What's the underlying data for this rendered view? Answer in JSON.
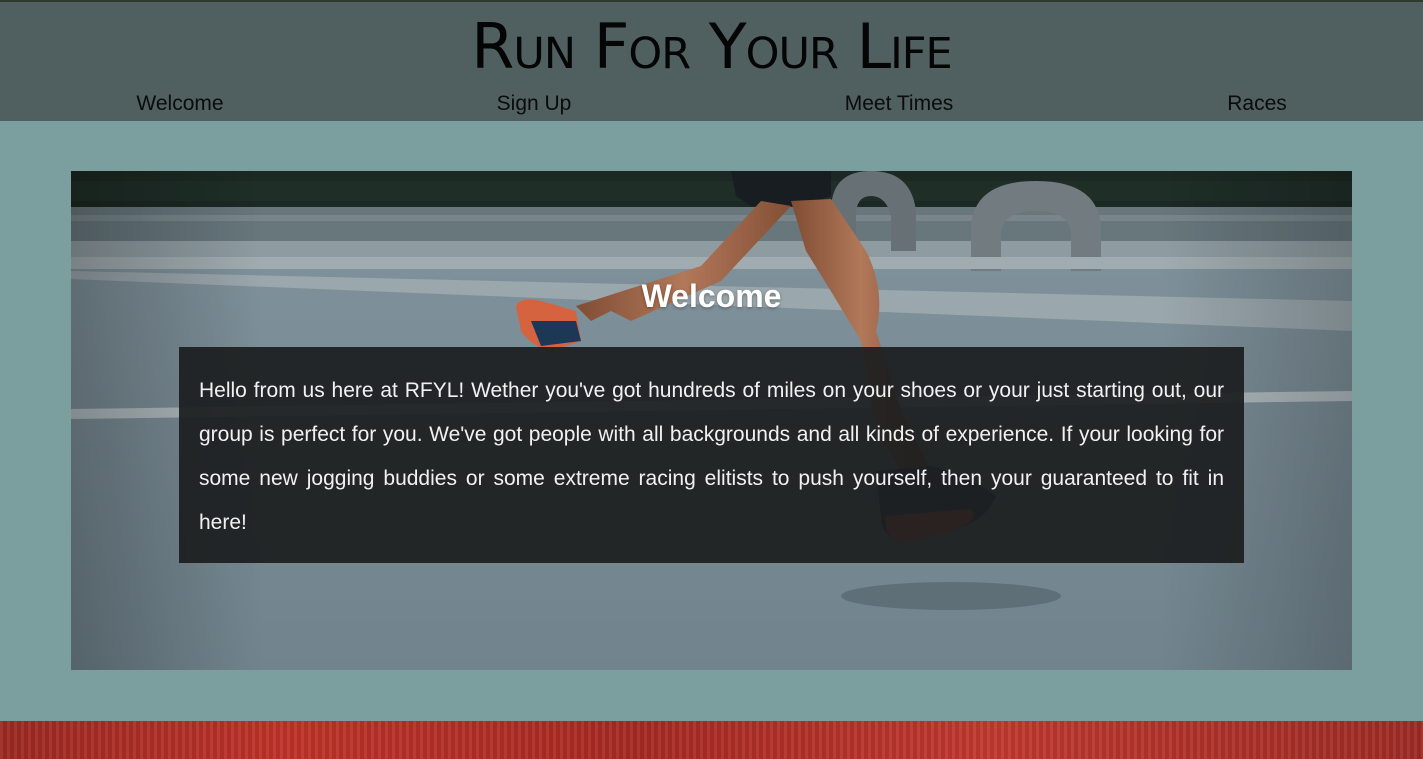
{
  "header": {
    "title": "Run For Your Life",
    "nav": [
      {
        "label": "Welcome"
      },
      {
        "label": "Sign Up"
      },
      {
        "label": "Meet Times"
      },
      {
        "label": "Races"
      }
    ]
  },
  "main": {
    "hero_image": "runner-on-road-photo",
    "heading": "Welcome",
    "body": "Hello from us here at RFYL! Wether you've got hundreds of miles on your shoes or your just starting out, our group is perfect for you. We've got people with all backgrounds and all kinds of experience. If your looking for some new jogging buddies or some extreme racing elitists to push yourself, then your guaranteed to fit in here!"
  },
  "colors": {
    "header_bg": "#505f60",
    "page_bg": "#7b9e9e",
    "box_bg": "#1c1e1f",
    "footer_accent": "#c0342a"
  }
}
